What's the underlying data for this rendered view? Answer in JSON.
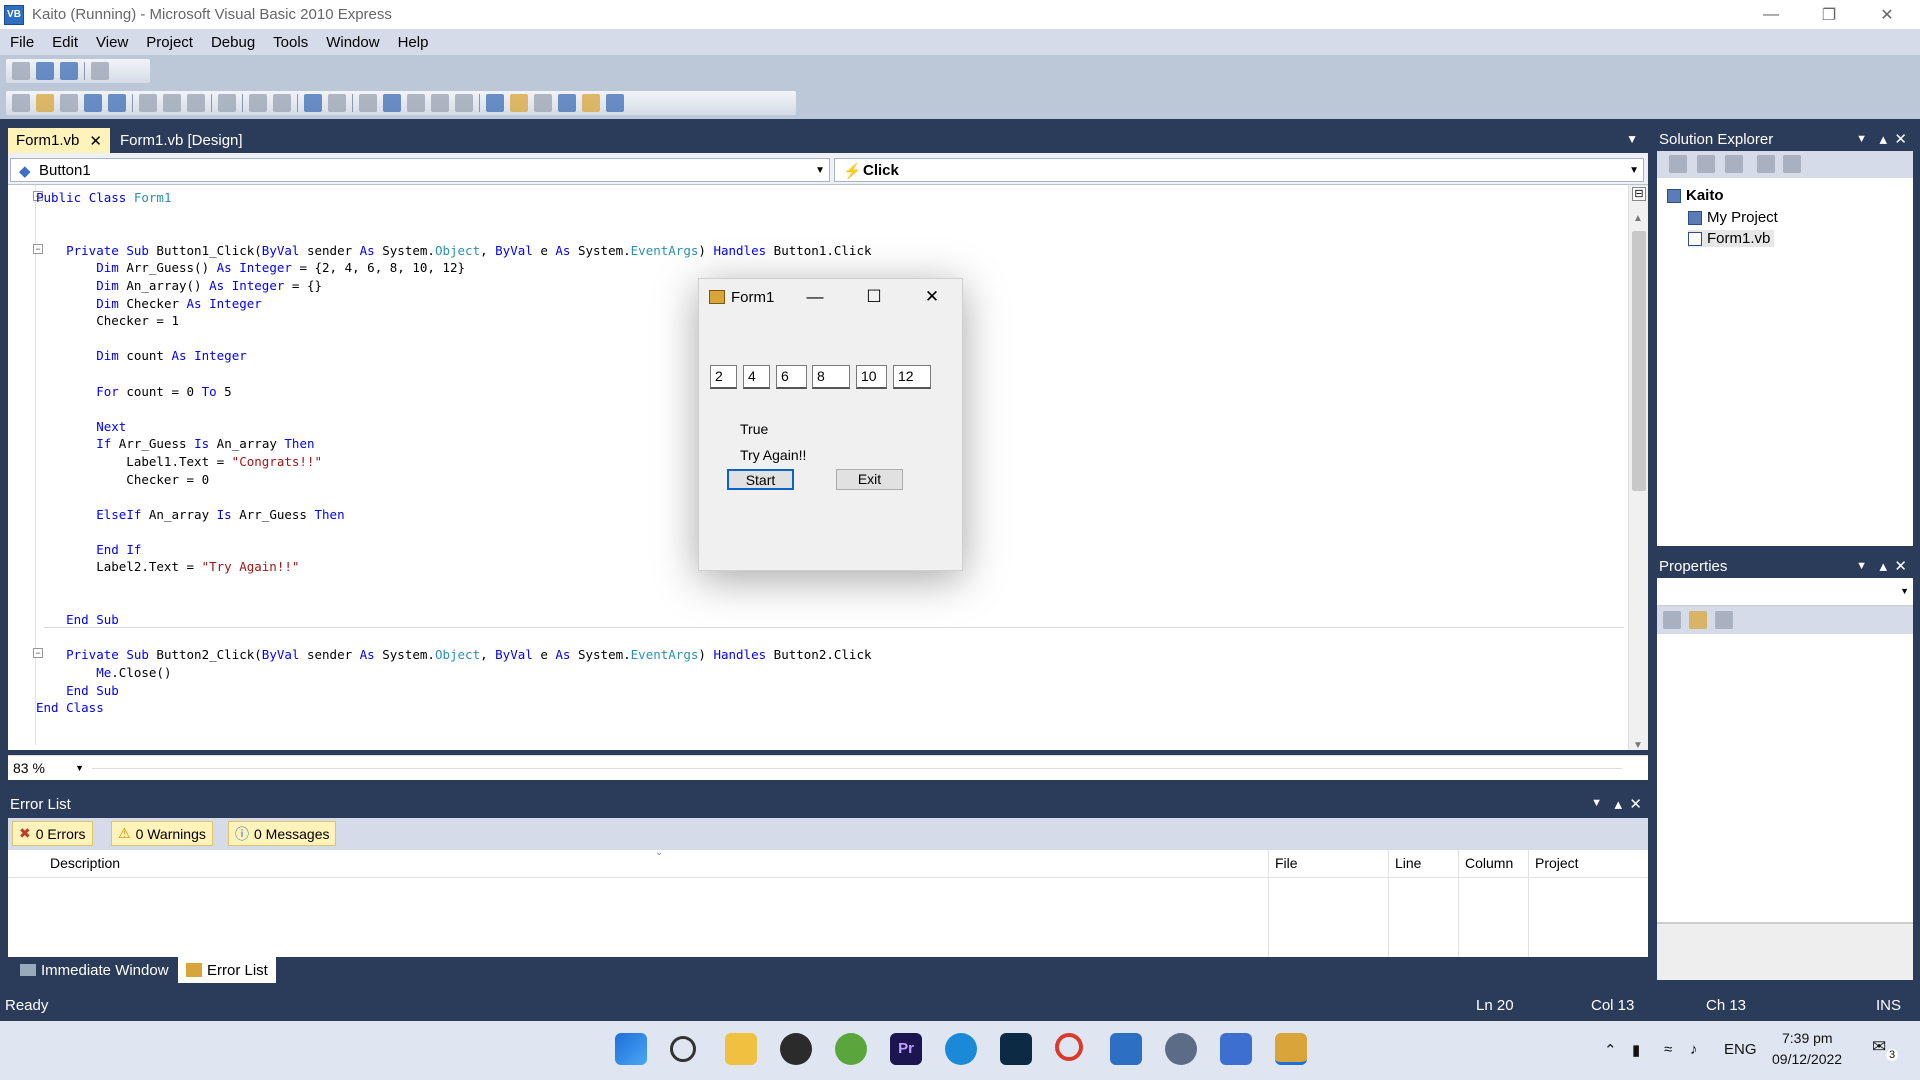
{
  "window": {
    "title": "Kaito (Running) - Microsoft Visual Basic 2010 Express"
  },
  "menu": [
    "File",
    "Edit",
    "View",
    "Project",
    "Debug",
    "Tools",
    "Window",
    "Help"
  ],
  "doc_tabs": [
    {
      "label": "Form1.vb"
    },
    {
      "label": "Form1.vb [Design]"
    }
  ],
  "nav": {
    "object": "Button1",
    "event": "Click"
  },
  "code_lines": [
    "Public Class Form1",
    "",
    "",
    "    Private Sub Button1_Click(ByVal sender As System.Object, ByVal e As System.EventArgs) Handles Button1.Click",
    "        Dim Arr_Guess() As Integer = {2, 4, 6, 8, 10, 12}",
    "        Dim An_array() As Integer = {}",
    "        Dim Checker As Integer",
    "        Checker = 1",
    "",
    "        Dim count As Integer",
    "",
    "        For count = 0 To 5",
    "",
    "        Next",
    "        If Arr_Guess Is An_array Then",
    "            Label1.Text = \"Congrats!!\"",
    "            Checker = 0",
    "",
    "        ElseIf An_array Is Arr_Guess Then",
    "",
    "        End If",
    "        Label2.Text = \"Try Again!!\"",
    "",
    "",
    "    End Sub",
    "",
    "    Private Sub Button2_Click(ByVal sender As System.Object, ByVal e As System.EventArgs) Handles Button2.Click",
    "        Me.Close()",
    "    End Sub",
    "End Class"
  ],
  "zoom": "83 %",
  "form1": {
    "title": "Form1",
    "textboxes": [
      "2",
      "4",
      "6",
      "8",
      "10",
      "12"
    ],
    "label1": "True",
    "label2": "Try Again!!",
    "start_label": "Start",
    "exit_label": "Exit"
  },
  "solution_explorer": {
    "title": "Solution Explorer",
    "project": "Kaito",
    "items": [
      "My Project",
      "Form1.vb"
    ]
  },
  "properties": {
    "title": "Properties"
  },
  "error_list": {
    "title": "Error List",
    "errors": "0 Errors",
    "warnings": "0 Warnings",
    "messages": "0 Messages",
    "columns": [
      "Description",
      "File",
      "Line",
      "Column",
      "Project"
    ]
  },
  "bottom_tabs": [
    "Immediate Window",
    "Error List"
  ],
  "status": {
    "text": "Ready",
    "ln": "Ln 20",
    "col": "Col 13",
    "ch": "Ch 13",
    "mode": "INS"
  },
  "taskbar": {
    "lang": "ENG",
    "time": "7:39 pm",
    "date": "09/12/2022",
    "notifications": "3"
  },
  "colors": {
    "accent": "#2b3b5a",
    "tab_active": "#fff3b9",
    "keyword": "#0000ff",
    "type": "#2b91af",
    "string": "#a31515"
  }
}
